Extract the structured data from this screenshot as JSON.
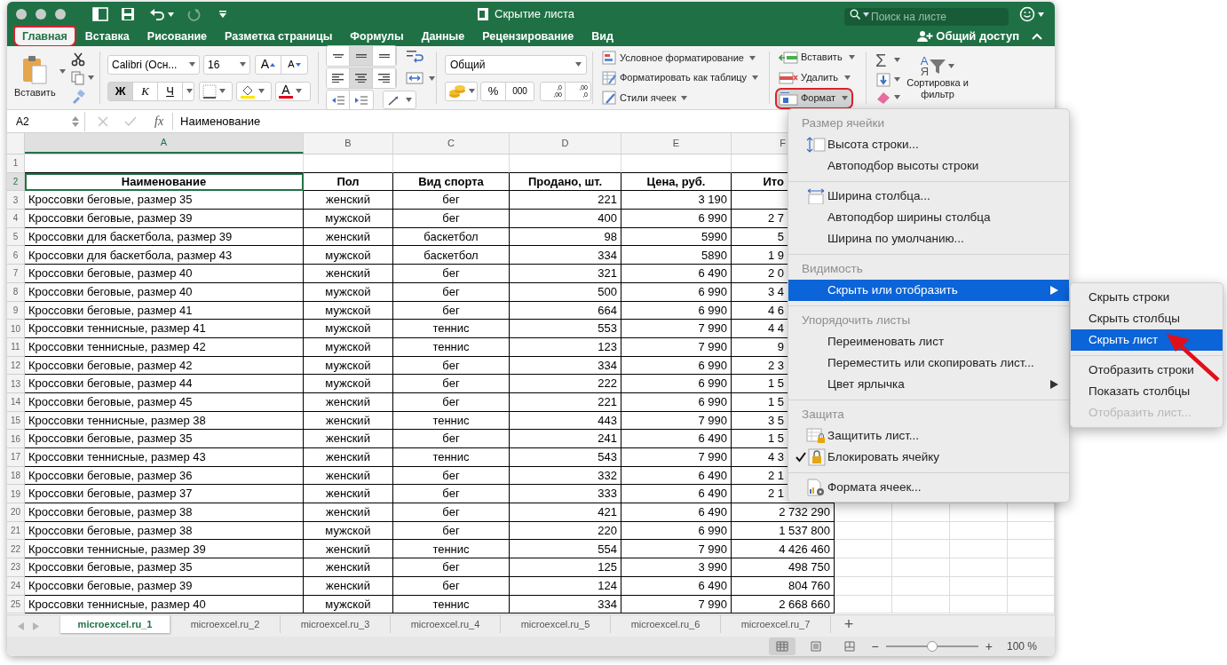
{
  "title_bar": {
    "title": "Скрытие листа",
    "search": {
      "placeholder": "Поиск на листе"
    }
  },
  "ribbon_tabs": [
    {
      "label": "Главная",
      "selected": true,
      "highlighted": true
    },
    {
      "label": "Вставка",
      "selected": false,
      "highlighted": false
    },
    {
      "label": "Рисование",
      "selected": false,
      "highlighted": false
    },
    {
      "label": "Разметка страницы",
      "selected": false,
      "highlighted": false
    },
    {
      "label": "Формулы",
      "selected": false,
      "highlighted": false
    },
    {
      "label": "Данные",
      "selected": false,
      "highlighted": false
    },
    {
      "label": "Рецензирование",
      "selected": false,
      "highlighted": false
    },
    {
      "label": "Вид",
      "selected": false,
      "highlighted": false
    }
  ],
  "share": "Общий доступ",
  "ribbon": {
    "clipboard": {
      "paste": "Вставить"
    },
    "font": {
      "name": "Calibri (Осн...",
      "size": "16",
      "grow": "A",
      "shrink": "A",
      "font_color": "A",
      "styles": [
        {
          "kind": "bold",
          "label": "Ж",
          "on": true
        },
        {
          "kind": "italic",
          "label": "К",
          "on": false
        },
        {
          "kind": "underline",
          "label": "Ч",
          "on": false
        }
      ]
    },
    "alignment": {
      "vertical": [
        {
          "on": false
        },
        {
          "on": true
        },
        {
          "on": false
        }
      ],
      "horizontal": [
        {
          "on": false
        },
        {
          "on": true
        },
        {
          "on": false
        }
      ]
    },
    "number": {
      "format": "Общий",
      "percent": "%",
      "thousands": "000",
      "increase_decimal": [
        ",0",
        ",00"
      ],
      "decrease_decimal": [
        ",00",
        ",0"
      ]
    },
    "styles": [
      "Условное форматирование",
      "Форматировать как таблицу",
      "Стили ячеек"
    ],
    "cells": [
      {
        "label": "Вставить",
        "highlighted": false
      },
      {
        "label": "Удалить",
        "highlighted": false
      },
      {
        "label": "Формат",
        "highlighted": true
      }
    ],
    "editing": {
      "sum": "Σ",
      "sort_letters": [
        "А",
        "Я"
      ],
      "sort_filter": "Сортировка и фильтр"
    }
  },
  "formula_bar": {
    "cell": "A2",
    "fx": "fx",
    "value": "Наименование"
  },
  "columns": [
    {
      "label": "A",
      "selected": true
    },
    {
      "label": "B",
      "selected": false
    },
    {
      "label": "C",
      "selected": false
    },
    {
      "label": "D",
      "selected": false
    },
    {
      "label": "E",
      "selected": false
    },
    {
      "label": "F",
      "selected": false
    }
  ],
  "rows": [
    {
      "number": "1",
      "kind": "blank",
      "selected": false,
      "cells": []
    },
    {
      "number": "2",
      "kind": "header",
      "selected": true,
      "cells": [
        "Наименование",
        "Пол",
        "Вид спорта",
        "Продано, шт.",
        "Цена, руб.",
        "Ито"
      ]
    },
    {
      "number": "3",
      "kind": "data",
      "selected": false,
      "cells": [
        "Кроссовки беговые, размер 35",
        "женский",
        "бег",
        "221",
        "3 190"
      ]
    },
    {
      "number": "4",
      "kind": "data",
      "selected": false,
      "cells": [
        "Кроссовки беговые, размер 39",
        "мужской",
        "бег",
        "400",
        "6 990",
        "2 7"
      ]
    },
    {
      "number": "5",
      "kind": "data",
      "selected": false,
      "cells": [
        "Кроссовки для баскетбола, размер 39",
        "женский",
        "баскетбол",
        "98",
        "5990",
        "5"
      ]
    },
    {
      "number": "6",
      "kind": "data",
      "selected": false,
      "cells": [
        "Кроссовки для баскетбола, размер 43",
        "мужской",
        "баскетбол",
        "334",
        "5890",
        "1 9"
      ]
    },
    {
      "number": "7",
      "kind": "data",
      "selected": false,
      "cells": [
        "Кроссовки беговые, размер 40",
        "женский",
        "бег",
        "321",
        "6 490",
        "2 0"
      ]
    },
    {
      "number": "8",
      "kind": "data",
      "selected": false,
      "cells": [
        "Кроссовки беговые, размер 40",
        "мужской",
        "бег",
        "500",
        "6 990",
        "3 4"
      ]
    },
    {
      "number": "9",
      "kind": "data",
      "selected": false,
      "cells": [
        "Кроссовки беговые, размер 41",
        "мужской",
        "бег",
        "664",
        "6 990",
        "4 6"
      ]
    },
    {
      "number": "10",
      "kind": "data",
      "selected": false,
      "cells": [
        "Кроссовки теннисные, размер 41",
        "мужской",
        "теннис",
        "553",
        "7 990",
        "4 4"
      ]
    },
    {
      "number": "11",
      "kind": "data",
      "selected": false,
      "cells": [
        "Кроссовки теннисные, размер 42",
        "мужской",
        "теннис",
        "123",
        "7 990",
        "9"
      ]
    },
    {
      "number": "12",
      "kind": "data",
      "selected": false,
      "cells": [
        "Кроссовки беговые, размер 42",
        "мужской",
        "бег",
        "334",
        "6 990",
        "2 3"
      ]
    },
    {
      "number": "13",
      "kind": "data",
      "selected": false,
      "cells": [
        "Кроссовки беговые, размер 44",
        "мужской",
        "бег",
        "222",
        "6 990",
        "1 5"
      ]
    },
    {
      "number": "14",
      "kind": "data",
      "selected": false,
      "cells": [
        "Кроссовки беговые, размер 45",
        "женский",
        "бег",
        "221",
        "6 990",
        "1 5"
      ]
    },
    {
      "number": "15",
      "kind": "data",
      "selected": false,
      "cells": [
        "Кроссовки теннисные, размер 38",
        "женский",
        "теннис",
        "443",
        "7 990",
        "3 5"
      ]
    },
    {
      "number": "16",
      "kind": "data",
      "selected": false,
      "cells": [
        "Кроссовки беговые, размер 35",
        "женский",
        "бег",
        "241",
        "6 490",
        "1 5"
      ]
    },
    {
      "number": "17",
      "kind": "data",
      "selected": false,
      "cells": [
        "Кроссовки теннисные, размер 43",
        "женский",
        "теннис",
        "543",
        "7 990",
        "4 3"
      ]
    },
    {
      "number": "18",
      "kind": "data",
      "selected": false,
      "cells": [
        "Кроссовки беговые, размер 36",
        "женский",
        "бег",
        "332",
        "6 490",
        "2 1"
      ]
    },
    {
      "number": "19",
      "kind": "data",
      "selected": false,
      "cells": [
        "Кроссовки беговые, размер 37",
        "женский",
        "бег",
        "333",
        "6 490",
        "2 1"
      ]
    },
    {
      "number": "20",
      "kind": "data",
      "selected": false,
      "cells": [
        "Кроссовки беговые, размер 38",
        "женский",
        "бег",
        "421",
        "6 490",
        "2 732 290"
      ]
    },
    {
      "number": "21",
      "kind": "data",
      "selected": false,
      "cells": [
        "Кроссовки беговые, размер 38",
        "мужской",
        "бег",
        "220",
        "6 990",
        "1 537 800"
      ]
    },
    {
      "number": "22",
      "kind": "data",
      "selected": false,
      "cells": [
        "Кроссовки теннисные, размер 39",
        "женский",
        "теннис",
        "554",
        "7 990",
        "4 426 460"
      ]
    },
    {
      "number": "23",
      "kind": "data",
      "selected": false,
      "cells": [
        "Кроссовки беговые, размер 35",
        "женский",
        "бег",
        "125",
        "3 990",
        "498 750"
      ]
    },
    {
      "number": "24",
      "kind": "data",
      "selected": false,
      "cells": [
        "Кроссовки беговые, размер 39",
        "женский",
        "бег",
        "124",
        "6 490",
        "804 760"
      ]
    },
    {
      "number": "25",
      "kind": "data",
      "selected": false,
      "cells": [
        "Кроссовки теннисные, размер 40",
        "мужской",
        "теннис",
        "334",
        "7 990",
        "2 668 660"
      ]
    }
  ],
  "format_menu": {
    "sections": [
      {
        "header": "Размер ячейки",
        "items": [
          {
            "label": "Высота строки...",
            "selected": false,
            "checked": false,
            "submenu": false
          },
          {
            "label": "Автоподбор высоты строки",
            "selected": false,
            "checked": false,
            "submenu": false
          }
        ]
      },
      {
        "items": [
          {
            "label": "Ширина столбца...",
            "selected": false,
            "checked": false,
            "submenu": false
          },
          {
            "label": "Автоподбор ширины столбца",
            "selected": false,
            "checked": false,
            "submenu": false
          },
          {
            "label": "Ширина по умолчанию...",
            "selected": false,
            "checked": false,
            "submenu": false
          }
        ]
      },
      {
        "header": "Видимость",
        "items": [
          {
            "label": "Скрыть или отобразить",
            "selected": true,
            "checked": false,
            "submenu": true
          }
        ]
      },
      {
        "header": "Упорядочить листы",
        "items": [
          {
            "label": "Переименовать лист",
            "selected": false,
            "checked": false,
            "submenu": false
          },
          {
            "label": "Переместить или скопировать лист...",
            "selected": false,
            "checked": false,
            "submenu": false
          },
          {
            "label": "Цвет ярлычка",
            "selected": false,
            "checked": false,
            "submenu": true
          }
        ]
      },
      {
        "header": "Защита",
        "items": [
          {
            "label": "Защитить лист...",
            "selected": false,
            "checked": false,
            "submenu": false
          },
          {
            "label": "Блокировать ячейку",
            "selected": false,
            "checked": true,
            "submenu": false
          }
        ]
      },
      {
        "items": [
          {
            "label": "Формата ячеек...",
            "selected": false,
            "checked": false,
            "submenu": false
          }
        ]
      }
    ]
  },
  "submenu": [
    [
      {
        "label": "Скрыть строки",
        "selected": false,
        "disabled": false
      },
      {
        "label": "Скрыть столбцы",
        "selected": false,
        "disabled": false
      },
      {
        "label": "Скрыть лист",
        "selected": true,
        "disabled": false
      }
    ],
    [
      {
        "label": "Отобразить строки",
        "selected": false,
        "disabled": false
      },
      {
        "label": "Показать столбцы",
        "selected": false,
        "disabled": false
      },
      {
        "label": "Отобразить лист...",
        "selected": false,
        "disabled": true
      }
    ]
  ],
  "sheet_tabs": [
    {
      "label": "microexcel.ru_1",
      "selected": true
    },
    {
      "label": "microexcel.ru_2",
      "selected": false
    },
    {
      "label": "microexcel.ru_3",
      "selected": false
    },
    {
      "label": "microexcel.ru_4",
      "selected": false
    },
    {
      "label": "microexcel.ru_5",
      "selected": false
    },
    {
      "label": "microexcel.ru_6",
      "selected": false
    },
    {
      "label": "microexcel.ru_7",
      "selected": false
    }
  ],
  "add_sheet": "+",
  "status_bar": {
    "views": [
      {
        "selected": true
      },
      {
        "selected": false
      },
      {
        "selected": false
      }
    ],
    "zoom_out": "−",
    "zoom_in": "+",
    "zoom": {
      "level": 0.5
    },
    "zoom_text": "100 %"
  }
}
